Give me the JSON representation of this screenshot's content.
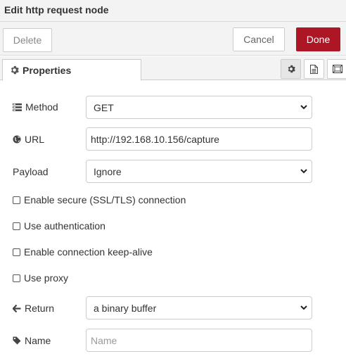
{
  "dialog": {
    "title": "Edit http request node",
    "delete_label": "Delete",
    "cancel_label": "Cancel",
    "done_label": "Done",
    "accent_color": "#ad1625"
  },
  "tabs": {
    "properties_label": "Properties",
    "icons": [
      "gear-icon",
      "description-icon",
      "appearance-icon"
    ]
  },
  "form": {
    "method": {
      "label": "Method",
      "value": "GET"
    },
    "url": {
      "label": "URL",
      "value": "http://192.168.10.156/capture"
    },
    "payload": {
      "label": "Payload",
      "value": "Ignore"
    },
    "checkboxes": [
      {
        "label": "Enable secure (SSL/TLS) connection",
        "checked": false
      },
      {
        "label": "Use authentication",
        "checked": false
      },
      {
        "label": "Enable connection keep-alive",
        "checked": false
      },
      {
        "label": "Use proxy",
        "checked": false
      }
    ],
    "return": {
      "label": "Return",
      "value": "a binary buffer"
    },
    "name": {
      "label": "Name",
      "value": "",
      "placeholder": "Name"
    }
  }
}
